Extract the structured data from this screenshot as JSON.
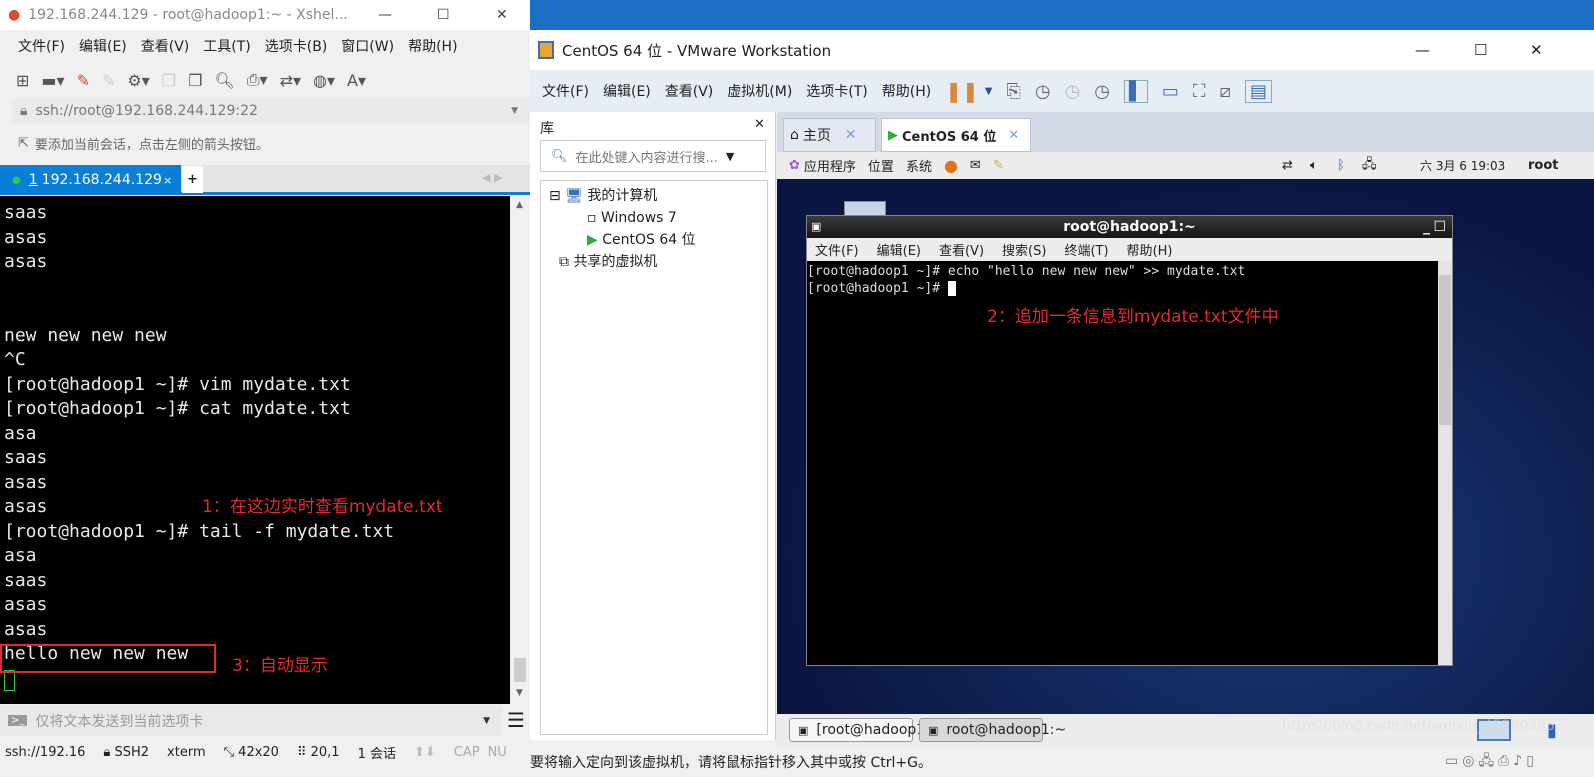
{
  "xshell": {
    "title": "192.168.244.129 - root@hadoop1:~ - Xshel...",
    "menu": [
      "文件(F)",
      "编辑(E)",
      "查看(V)",
      "工具(T)",
      "选项卡(B)",
      "窗口(W)",
      "帮助(H)"
    ],
    "address": "ssh://root@192.168.244.129:22",
    "hint": "要添加当前会话，点击左侧的箭头按钮。",
    "tab": {
      "number": "1",
      "label": "192.168.244.129"
    },
    "terminal_lines": [
      "saas",
      "asas",
      "asas",
      "",
      "",
      "new new new new",
      "^C",
      "[root@hadoop1 ~]# vim mydate.txt",
      "[root@hadoop1 ~]# cat mydate.txt",
      "asa",
      "saas",
      "asas",
      "asas",
      "[root@hadoop1 ~]# tail -f mydate.txt",
      "asa",
      "saas",
      "asas",
      "asas",
      "hello new new new"
    ],
    "annotation1": "1：在这边实时查看mydate.txt",
    "annotation3": "3：自动显示",
    "send_placeholder": "仅将文本发送到当前选项卡",
    "status": {
      "conn": "ssh://192.16",
      "proto": "SSH2",
      "term": "xterm",
      "size": "42x20",
      "pos": "20,1",
      "sessions": "1 会话",
      "cap": "CAP",
      "num": "NU"
    }
  },
  "vmware": {
    "title": "CentOS 64 位 - VMware Workstation",
    "menu": [
      "文件(F)",
      "编辑(E)",
      "查看(V)",
      "虚拟机(M)",
      "选项卡(T)",
      "帮助(H)"
    ],
    "library": {
      "title": "库",
      "search_placeholder": "在此处键入内容进行搜...",
      "tree": {
        "root": "我的计算机",
        "vms": [
          "Windows 7",
          "CentOS 64 位"
        ],
        "shared": "共享的虚拟机"
      }
    },
    "tabs": [
      "主页",
      "CentOS 64 位"
    ],
    "guest_panel": {
      "menus": [
        "应用程序",
        "位置",
        "系统"
      ],
      "clock": "六 3月  6 19:03",
      "user": "root"
    },
    "guest_terminal": {
      "title": "root@hadoop1:~",
      "menu": [
        "文件(F)",
        "编辑(E)",
        "查看(V)",
        "搜索(S)",
        "终端(T)",
        "帮助(H)"
      ],
      "lines": [
        "[root@hadoop1 ~]# echo \"hello new new new\" >> mydate.txt",
        "[root@hadoop1 ~]# "
      ],
      "annotation2": "2：追加一条信息到mydate.txt文件中"
    },
    "taskbar": [
      "[root@hadoop1:~/...",
      "root@hadoop1:~"
    ],
    "status_text": "要将输入定向到该虚拟机，请将鼠标指针移入其中或按 Ctrl+G。",
    "watermark": "https://blog.csdn.net/weixin_45260385"
  }
}
